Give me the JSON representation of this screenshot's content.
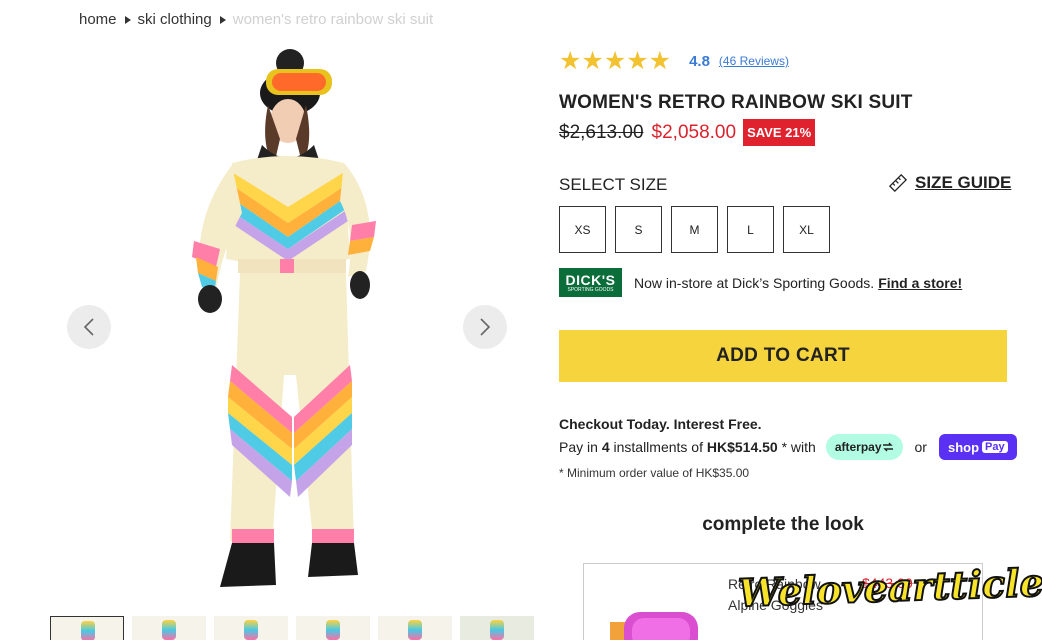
{
  "breadcrumb": {
    "home": "home",
    "category": "ski clothing",
    "current": "women's retro rainbow ski suit"
  },
  "gallery": {
    "prev_icon": "chevron-left-icon",
    "next_icon": "chevron-right-icon",
    "thumbnail_count": 6
  },
  "rating": {
    "stars": "★★★★★",
    "value": "4.8",
    "reviews": "(46 Reviews)",
    "star_color": "#f2c230"
  },
  "product": {
    "title": "WOMEN'S RETRO RAINBOW SKI SUIT",
    "old_price": "$2,613.00",
    "new_price": "$2,058.00",
    "save_badge": "SAVE 21%"
  },
  "sizes": {
    "label": "SELECT SIZE",
    "guide": "SIZE GUIDE",
    "options": [
      "XS",
      "S",
      "M",
      "L",
      "XL"
    ]
  },
  "dicks": {
    "logo_line1": "DICK'S",
    "logo_line2": "SPORTING GOODS",
    "text": "Now in-store at Dick’s Sporting Goods.",
    "link": "Find a store!"
  },
  "cart": {
    "button": "ADD TO CART",
    "button_color": "#f6d43e"
  },
  "checkout": {
    "heading": "Checkout Today. Interest Free.",
    "pay_in": "Pay in",
    "installments_count": "4",
    "installments_of": "installments of",
    "amount": "HK$514.50",
    "with": "* with",
    "afterpay": "afterpay",
    "or": "or",
    "shop": "shop",
    "pay": "Pay",
    "minimum": "* Minimum order value of HK$35.00"
  },
  "complete_look": {
    "heading": "complete the look",
    "item_name": "Retro Rainbow Alpine Goggles",
    "item_price": "$443.00"
  },
  "watermark": "Weloveartticle"
}
